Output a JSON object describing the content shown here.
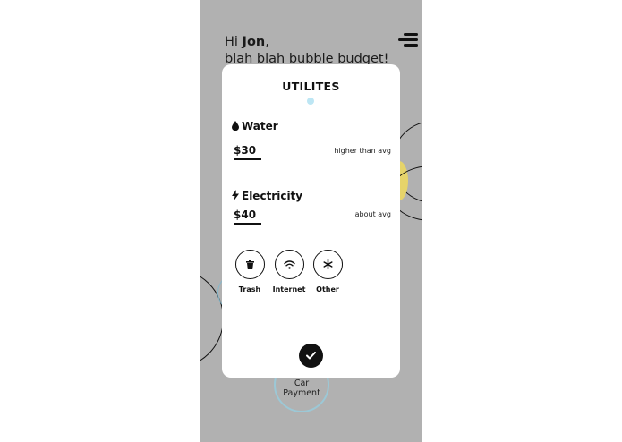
{
  "greeting": {
    "prefix": "Hi ",
    "name": "Jon",
    "suffix": ",",
    "subtitle": "blah blah bubble budget!"
  },
  "background_bubbles": {
    "car_payment_line1": "Car",
    "car_payment_line2": "Payment"
  },
  "modal": {
    "title": "UTILITES",
    "categories": [
      {
        "icon": "water-drop-icon",
        "label": "Water",
        "amount": "$30",
        "comparison": "higher than avg"
      },
      {
        "icon": "lightning-bolt-icon",
        "label": "Electricity",
        "amount": "$40",
        "comparison": "about avg"
      }
    ],
    "options": [
      {
        "icon": "trash-icon",
        "label": "Trash"
      },
      {
        "icon": "wifi-icon",
        "label": "Internet"
      },
      {
        "icon": "asterisk-icon",
        "label": "Other"
      }
    ],
    "confirm_icon": "checkmark-icon"
  },
  "colors": {
    "screen_background": "#b1b1b1",
    "modal_background": "#ffffff",
    "page_dot": "#bde6f4",
    "car_bubble_border": "#9cc8d6",
    "yellow_bubble": "#e6d46a",
    "text": "#111111"
  }
}
